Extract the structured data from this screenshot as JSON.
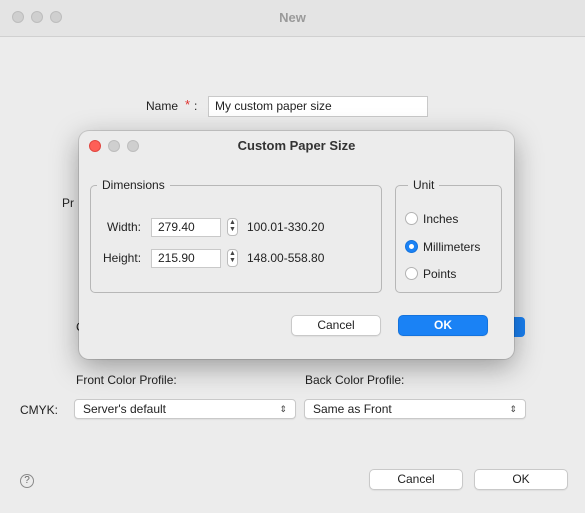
{
  "window": {
    "title": "New",
    "name_label": "Name",
    "required_mark": "*",
    "name_colon": ":",
    "name_value": "My custom paper size",
    "front_color_label": "Front Color Profile:",
    "back_color_label": "Back Color Profile:",
    "cmyk_label": "CMYK:",
    "front_color_value": "Server's default",
    "back_color_value": "Same as Front",
    "cancel_label": "Cancel",
    "ok_label": "OK",
    "help_glyph": "?",
    "partial_label_pr": "Pr",
    "partial_label_c": "C"
  },
  "dialog": {
    "title": "Custom Paper Size",
    "dimensions": {
      "title": "Dimensions",
      "width_label": "Width:",
      "width_value": "279.40",
      "width_range": "100.01-330.20",
      "height_label": "Height:",
      "height_value": "215.90",
      "height_range": "148.00-558.80"
    },
    "unit": {
      "title": "Unit",
      "options": [
        "Inches",
        "Millimeters",
        "Points"
      ],
      "selected": "Millimeters"
    },
    "cancel_label": "Cancel",
    "ok_label": "OK"
  },
  "colors": {
    "accent": "#1a82f5",
    "close_red": "#fe5f57",
    "required_red": "#e0302d"
  },
  "icons": {
    "stepper": "stepper-icon",
    "chevron": "chevron-updown-icon",
    "help": "help-icon"
  }
}
